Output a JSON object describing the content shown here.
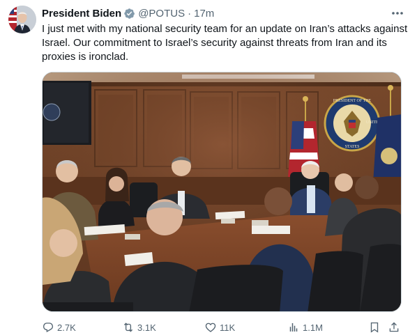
{
  "author": {
    "name": "President Biden",
    "handle": "@POTUS",
    "separator": "·",
    "time": "17m",
    "verified_icon": "gray-verified-badge-icon",
    "avatar": "president-avatar"
  },
  "tweet": {
    "text": "I just met with my national security team for an update on Iran’s attacks against Israel. Our commitment to Israel’s security against threats from Iran and its proxies is ironclad."
  },
  "media": {
    "description_icon": "situation-room-photo",
    "seal_top_text": "PRESIDENT OF THE",
    "seal_right_text": "UNITED",
    "seal_bottom_text": "STATES"
  },
  "actions": {
    "reply_count": "2.7K",
    "repost_count": "3.1K",
    "like_count": "11K",
    "views_count": "1.1M"
  },
  "colors": {
    "text_primary": "#0f1419",
    "text_secondary": "#536471",
    "border": "#cfd9de",
    "wood": "#6b3f27"
  }
}
